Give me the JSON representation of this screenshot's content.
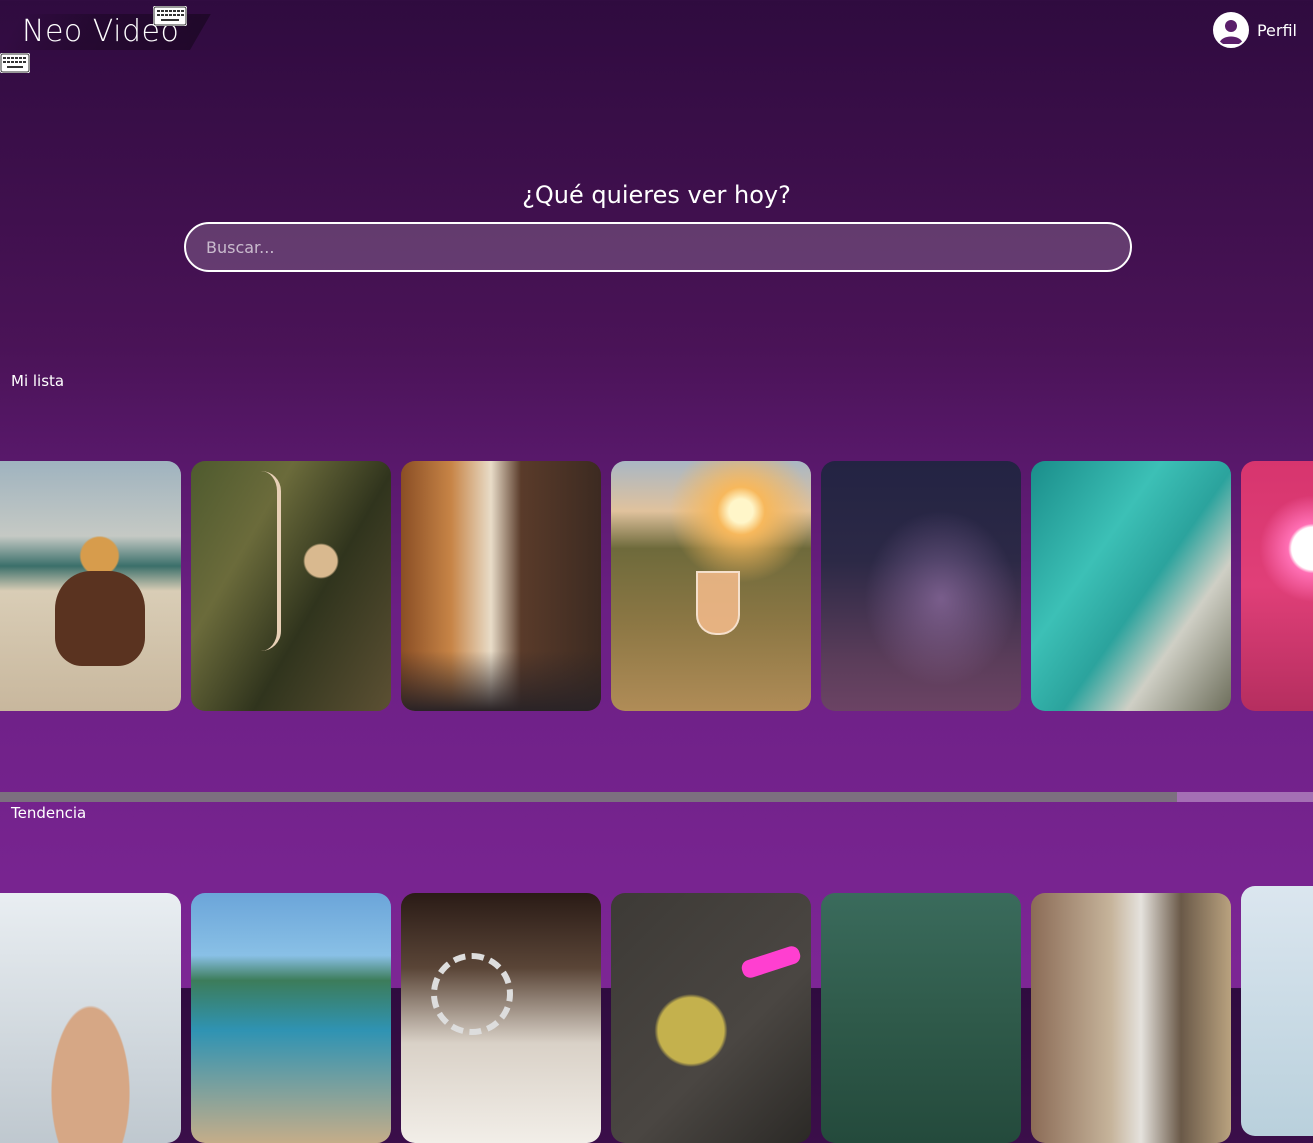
{
  "app": {
    "title": "Neo Video"
  },
  "header": {
    "profile_label": "Perfil"
  },
  "hero": {
    "title": "¿Qué quieres ver hoy?",
    "search_placeholder": "Buscar..."
  },
  "sections": [
    {
      "title": "Mi lista",
      "items": [
        "rodeo-horse",
        "archer",
        "city-street",
        "sunset-wine",
        "milky-way",
        "ocean-coast",
        "neon-sign"
      ]
    },
    {
      "title": "Tendencia",
      "items": [
        "smiling-woman",
        "beach-people",
        "restaurant-interior",
        "color-paint-man",
        "forest",
        "city-signs",
        "sky"
      ]
    }
  ],
  "icons": {
    "keyboard": "keyboard-icon",
    "profile": "user-avatar-icon"
  },
  "colors": {
    "background_top": "#2f0b3f",
    "background_bottom": "#7d2695",
    "scroll_thumb": "#7c6f7f"
  },
  "scroll": {
    "row_scroll_fraction": 0.9
  }
}
